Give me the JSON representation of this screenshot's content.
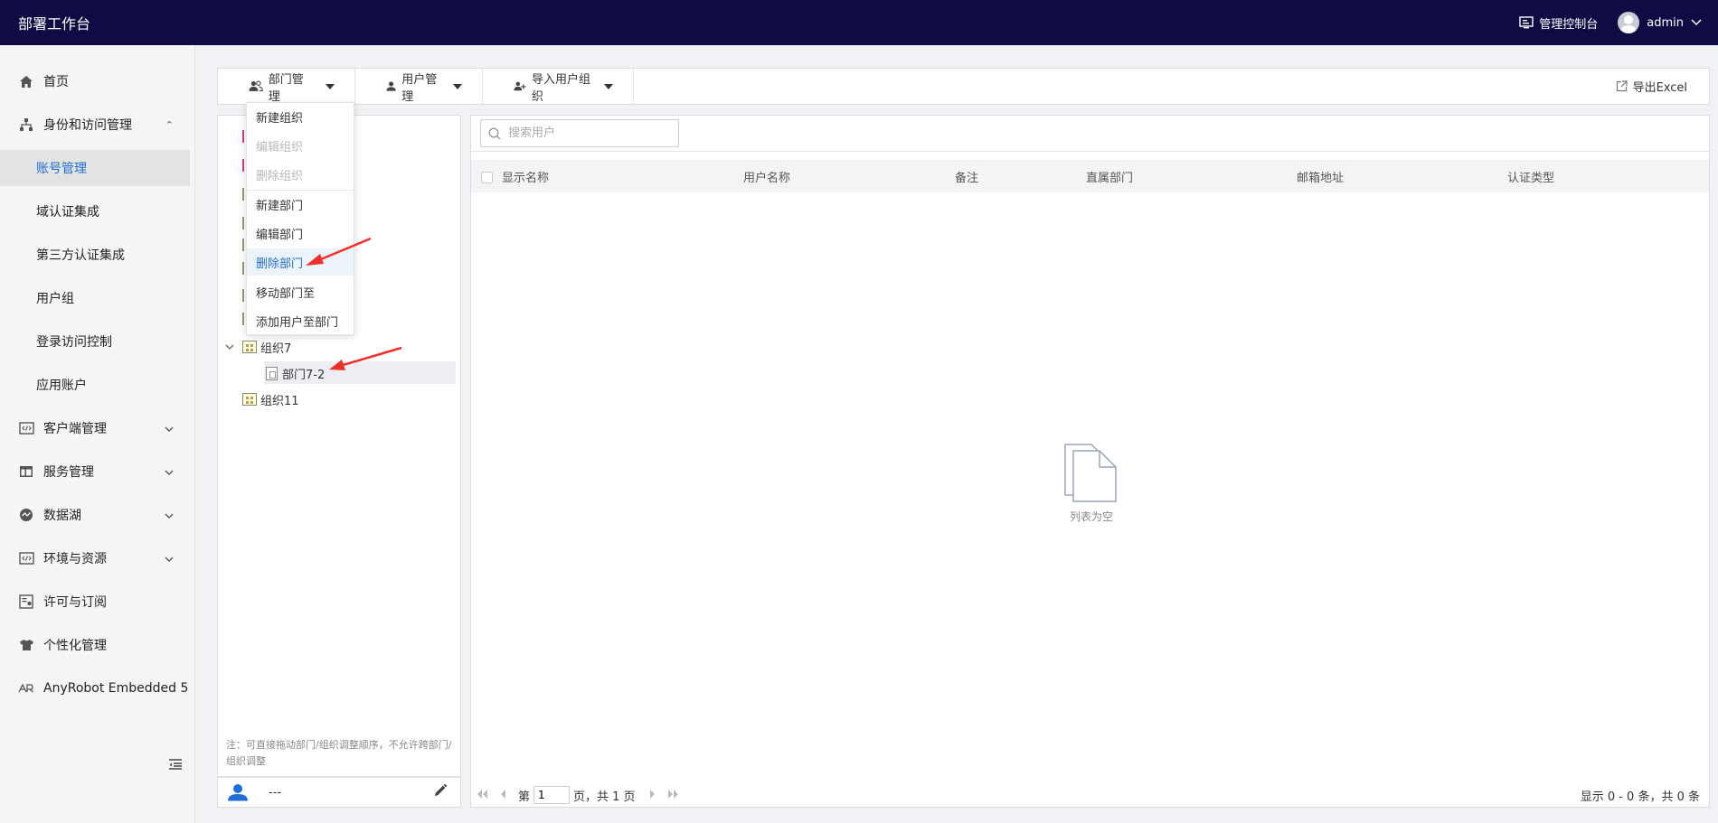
{
  "header": {
    "title": "部署工作台",
    "console_label": "管理控制台",
    "user_name": "admin"
  },
  "sidebar": {
    "items": [
      {
        "label": "首页",
        "icon": "home-icon"
      },
      {
        "label": "身份和访问管理",
        "icon": "org-tree-icon",
        "expanded": true
      },
      {
        "label": "客户端管理",
        "icon": "code-window-icon"
      },
      {
        "label": "服务管理",
        "icon": "layout-icon"
      },
      {
        "label": "数据湖",
        "icon": "datalake-icon"
      },
      {
        "label": "环境与资源",
        "icon": "code-window-icon"
      },
      {
        "label": "许可与订阅",
        "icon": "license-icon"
      },
      {
        "label": "个性化管理",
        "icon": "shirt-icon"
      },
      {
        "label": "AnyRobot Embedded 5",
        "icon": "anyrobot-icon"
      }
    ],
    "sub_items": [
      {
        "label": "账号管理",
        "active": true
      },
      {
        "label": "域认证集成"
      },
      {
        "label": "第三方认证集成"
      },
      {
        "label": "用户组"
      },
      {
        "label": "登录访问控制"
      },
      {
        "label": "应用账户"
      }
    ]
  },
  "toolbar": {
    "dept_mgmt": "部门管理",
    "user_mgmt": "用户管理",
    "import_groups": "导入用户组织",
    "export_excel": "导出Excel"
  },
  "dropdown": {
    "items": [
      {
        "label": "新建组织",
        "disabled": false
      },
      {
        "label": "编辑组织",
        "disabled": true
      },
      {
        "label": "删除组织",
        "disabled": true
      },
      {
        "label": "新建部门",
        "disabled": false
      },
      {
        "label": "编辑部门",
        "disabled": false
      },
      {
        "label": "删除部门",
        "disabled": false,
        "hover": true
      },
      {
        "label": "移动部门至",
        "disabled": false
      },
      {
        "label": "添加用户至部门",
        "disabled": false
      }
    ]
  },
  "tree": {
    "nodes": [
      {
        "label": "组织7",
        "expanded": true
      },
      {
        "label": "部门7-2",
        "selected": true
      },
      {
        "label": "组织11"
      }
    ],
    "note": "注：可直接拖动部门/组织调整顺序，不允许跨部门/组织调整",
    "footer_value": "---"
  },
  "search": {
    "placeholder": "搜索用户"
  },
  "table": {
    "columns": [
      "显示名称",
      "用户名称",
      "备注",
      "直属部门",
      "邮箱地址",
      "认证类型"
    ],
    "rows": [],
    "empty_text": "列表为空"
  },
  "pager": {
    "prefix": "第",
    "page": "1",
    "suffix": "页，共 1 页",
    "summary": "显示 0 - 0 条，共 0 条"
  },
  "colors": {
    "header_bg": "#0f0c45",
    "accent": "#1e6fd9",
    "annotation_arrow": "#f0302a"
  }
}
